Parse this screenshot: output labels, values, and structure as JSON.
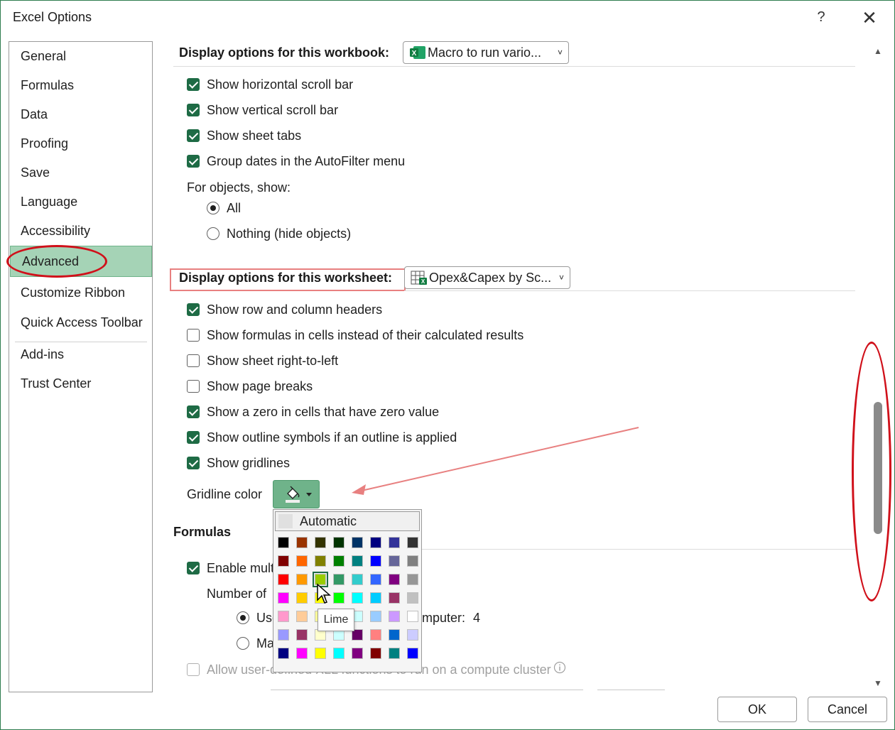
{
  "window": {
    "title": "Excel Options",
    "help_label": "?",
    "close_label": "✕"
  },
  "sidebar": {
    "items": [
      {
        "label": "General"
      },
      {
        "label": "Formulas"
      },
      {
        "label": "Data"
      },
      {
        "label": "Proofing"
      },
      {
        "label": "Save"
      },
      {
        "label": "Language"
      },
      {
        "label": "Accessibility"
      },
      {
        "label": "Advanced",
        "selected": true
      },
      {
        "label": "Customize Ribbon"
      },
      {
        "label": "Quick Access Toolbar"
      },
      {
        "label": "Add-ins"
      },
      {
        "label": "Trust Center"
      }
    ]
  },
  "workbook_section": {
    "header": "Display options for this workbook:",
    "dropdown_value": "Macro to run vario...",
    "options": [
      {
        "label": "Show horizontal scroll bar",
        "checked": true
      },
      {
        "label": "Show vertical scroll bar",
        "checked": true
      },
      {
        "label": "Show sheet tabs",
        "checked": true
      },
      {
        "label": "Group dates in the AutoFilter menu",
        "checked": true
      }
    ],
    "objects_label": "For objects, show:",
    "objects_options": [
      {
        "label": "All",
        "selected": true
      },
      {
        "label": "Nothing (hide objects)",
        "selected": false
      }
    ]
  },
  "worksheet_section": {
    "header": "Display options for this worksheet:",
    "dropdown_value": "Opex&Capex by Sc...",
    "options": [
      {
        "label": "Show row and column headers",
        "checked": true
      },
      {
        "label": "Show formulas in cells instead of their calculated results",
        "checked": false
      },
      {
        "label": "Show sheet right-to-left",
        "checked": false
      },
      {
        "label": "Show page breaks",
        "checked": false
      },
      {
        "label": "Show a zero in cells that have zero value",
        "checked": true
      },
      {
        "label": "Show outline symbols if an outline is applied",
        "checked": true
      },
      {
        "label": "Show gridlines",
        "checked": true
      }
    ],
    "gridline_color_label": "Gridline color"
  },
  "formulas_section": {
    "header": "Formulas",
    "enable_label": "Enable mult",
    "number_label": "Number of",
    "use_label": "Use",
    "computer_label": "mputer:",
    "computer_value": "4",
    "manual_label": "Ma",
    "allow_label": "Allow user-defined XLL functions to run on a compute cluster"
  },
  "palette": {
    "automatic_label": "Automatic",
    "tooltip": "Lime",
    "selected": "Lime",
    "rows": [
      [
        "#000000",
        "#993300",
        "#333300",
        "#003300",
        "#003366",
        "#000080",
        "#333399",
        "#333333"
      ],
      [
        "#800000",
        "#FF6600",
        "#808000",
        "#008000",
        "#008080",
        "#0000FF",
        "#666699",
        "#808080"
      ],
      [
        "#FF0000",
        "#FF9900",
        "#99CC00",
        "#339966",
        "#33CCCC",
        "#3366FF",
        "#800080",
        "#969696"
      ],
      [
        "#FF00FF",
        "#FFCC00",
        "#FFFF00",
        "#00FF00",
        "#00FFFF",
        "#00CCFF",
        "#993366",
        "#C0C0C0"
      ],
      [
        "#FF99CC",
        "#FFCC99",
        "#FFFF99",
        "#CCFFCC",
        "#CCFFFF",
        "#99CCFF",
        "#CC99FF",
        "#FFFFFF"
      ],
      [
        "#9999FF",
        "#993366",
        "#FFFFCC",
        "#CCFFFF",
        "#660066",
        "#FF8080",
        "#0066CC",
        "#CCCCFF"
      ],
      [
        "#000080",
        "#FF00FF",
        "#FFFF00",
        "#00FFFF",
        "#800080",
        "#800000",
        "#008080",
        "#0000FF"
      ]
    ]
  },
  "footer": {
    "ok_label": "OK",
    "cancel_label": "Cancel"
  },
  "colors": {
    "accent": "#1e6b45",
    "selected_nav": "#a5d3b6",
    "annotation": "#d0101a"
  }
}
